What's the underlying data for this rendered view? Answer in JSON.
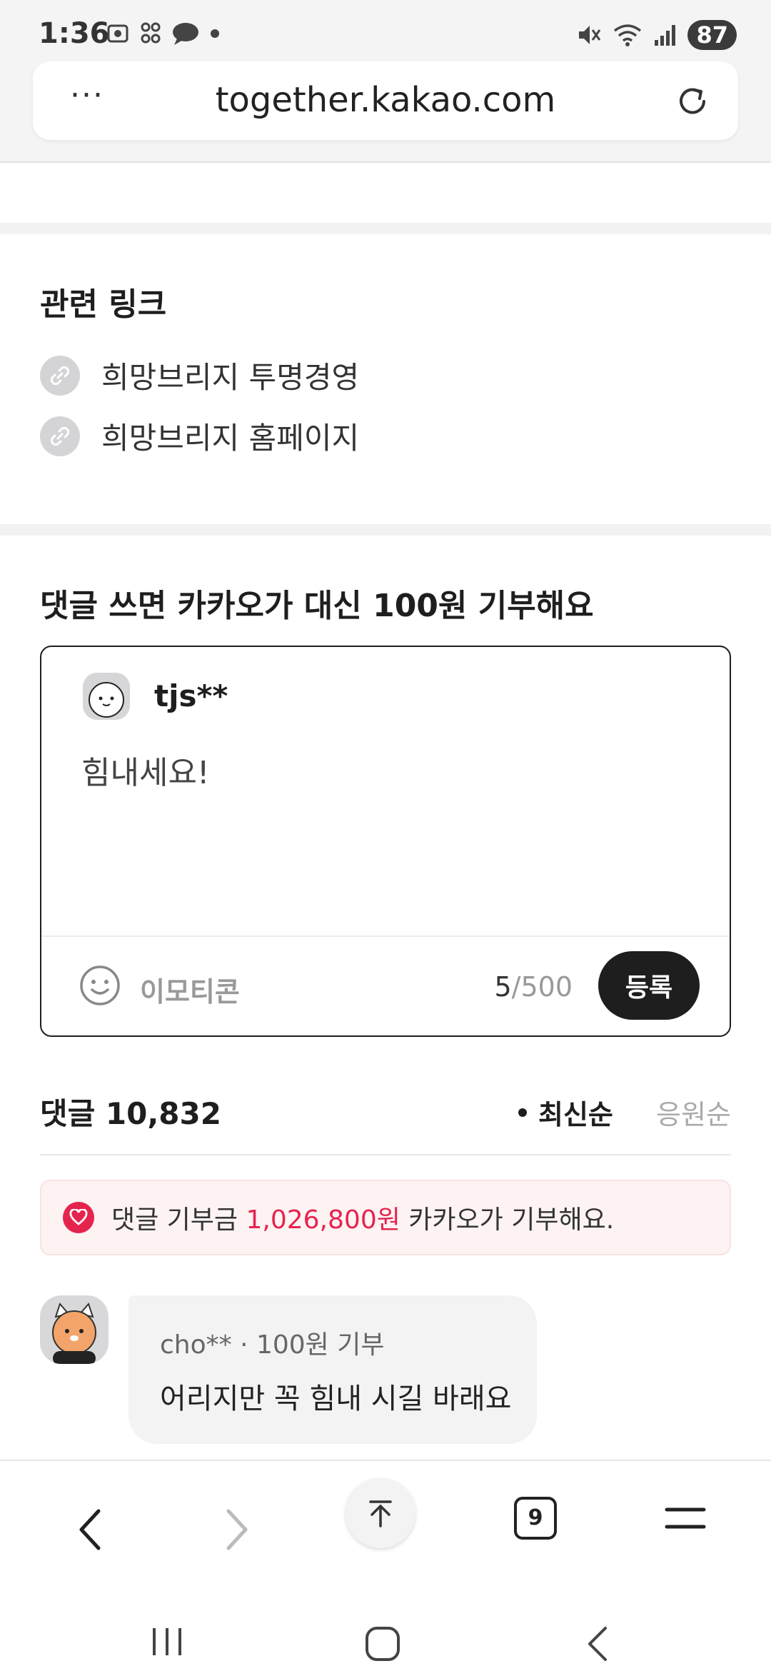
{
  "status_bar": {
    "time": "1:36",
    "battery": "87"
  },
  "browser": {
    "url": "together.kakao.com",
    "more_label": "···",
    "tab_count": "9"
  },
  "related_links": {
    "title": "관련 링크",
    "items": [
      {
        "label": "희망브리지 투명경영"
      },
      {
        "label": "희망브리지 홈페이지"
      }
    ]
  },
  "comment_form": {
    "heading": "댓글 쓰면 카카오가 대신 100원 기부해요",
    "username": "tjs**",
    "input_value": "힘내세요!",
    "emoticon_label": "이모티콘",
    "char_current": "5",
    "char_max": "/500",
    "submit_label": "등록"
  },
  "comments": {
    "count_label": "댓글 10,832",
    "sort_latest": "최신순",
    "sort_support": "응원순",
    "banner": {
      "prefix": "댓글 기부금 ",
      "amount": "1,026,800원",
      "suffix": " 카카오가 기부해요."
    },
    "items": [
      {
        "meta": "cho** · 100원 기부",
        "text": "어리지만 꼭 힘내 시길 바래요"
      }
    ]
  },
  "colors": {
    "accent_red": "#e5244e",
    "dark": "#1e1e1e",
    "muted": "#999999"
  }
}
